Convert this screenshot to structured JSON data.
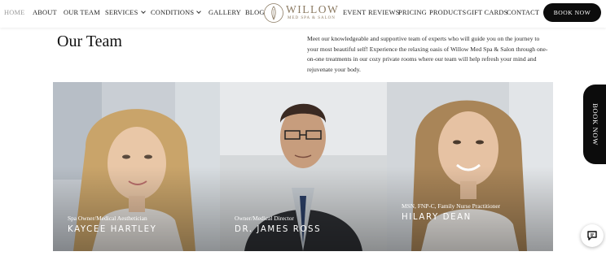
{
  "nav": {
    "home": "HOME",
    "about": "ABOUT",
    "our_team": "OUR TEAM",
    "services": "SERVICES",
    "conditions": "CONDITIONS",
    "gallery": "GALLERY",
    "blog": "BLOG",
    "event": "EVENT",
    "reviews": "REVIEWS",
    "pricing": "PRICING",
    "products": "PRODUCTS",
    "gift_cards": "GIFT CARDS",
    "contact": "CONTACT",
    "book_now": "BOOK NOW"
  },
  "logo": {
    "word": "WILLOW",
    "sub": "MED SPA & SALON",
    "icon": "willow-leaf-icon"
  },
  "intro": {
    "title": "Our Team",
    "text": "Meet our knowledgeable and supportive team of experts who will guide you on the journey to your most beautiful self! Experience the relaxing oasis of Willow Med Spa & Salon through one-on-one treatments in our cozy private rooms where our team will help refresh your mind and rejuvenate your body."
  },
  "team": [
    {
      "role": "Spa Owner/Medical Aesthetician",
      "name": "KAYCEE HARTLEY"
    },
    {
      "role": "Owner/Medical Director",
      "name": "DR. JAMES ROSS"
    },
    {
      "role": "MSN, FNP-C, Family Nurse Practitioner",
      "name": "HILARY DEAN"
    }
  ],
  "side_book": "BOOK NOW",
  "chat_icon": "chat-bubble-icon",
  "colors": {
    "accent": "#8c7b63",
    "button": "#0c0c0c",
    "active_nav": "#9a9a9a"
  }
}
